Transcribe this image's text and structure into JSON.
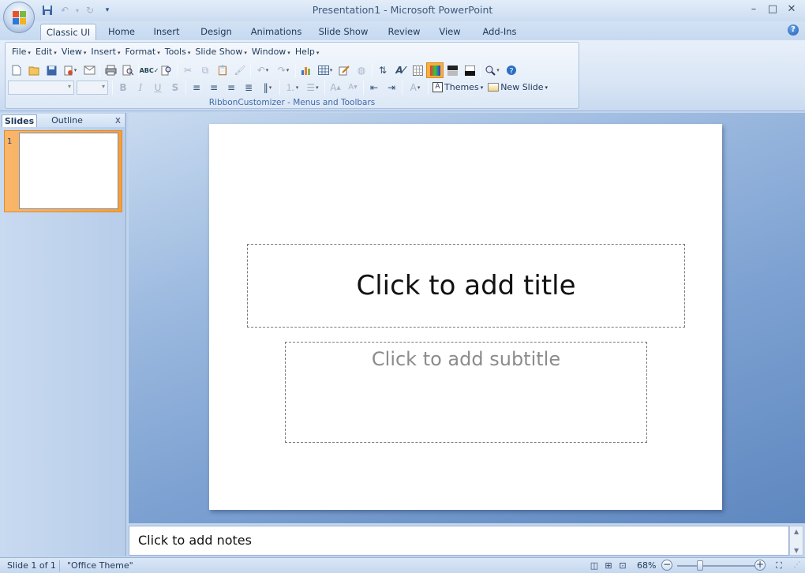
{
  "window": {
    "title": "Presentation1 - Microsoft PowerPoint",
    "minimize": "–",
    "maximize": "□",
    "close": "✕"
  },
  "quick_access": [
    "save-icon",
    "undo-icon",
    "redo-icon",
    "customize-icon"
  ],
  "ribbon_tabs": [
    {
      "label": "Classic UI",
      "active": true
    },
    {
      "label": "Home"
    },
    {
      "label": "Insert"
    },
    {
      "label": "Design"
    },
    {
      "label": "Animations"
    },
    {
      "label": "Slide Show"
    },
    {
      "label": "Review"
    },
    {
      "label": "View"
    },
    {
      "label": "Add-Ins"
    }
  ],
  "menus": [
    "File",
    "Edit",
    "View",
    "Insert",
    "Format",
    "Tools",
    "Slide Show",
    "Window",
    "Help"
  ],
  "toolbar": {
    "themes_label": "Themes",
    "new_slide_label": "New Slide",
    "group_label": "RibbonCustomizer - Menus and Toolbars"
  },
  "panel": {
    "tabs": [
      "Slides",
      "Outline"
    ],
    "close": "x",
    "slide_number": "1"
  },
  "slide": {
    "title_placeholder": "Click to add title",
    "subtitle_placeholder": "Click to add subtitle"
  },
  "notes": {
    "placeholder": "Click to add notes"
  },
  "status": {
    "slide_info": "Slide 1 of 1",
    "theme": "\"Office Theme\"",
    "zoom": "68%"
  },
  "colors": {
    "accent_orange": "#f59f3c",
    "ribbon_blue": "#c4d6ec"
  }
}
